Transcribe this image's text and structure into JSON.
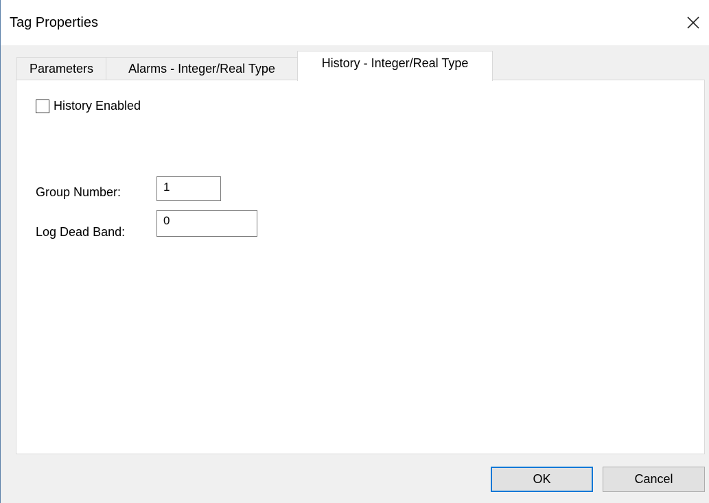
{
  "window": {
    "title": "Tag Properties",
    "close_icon": "close-icon"
  },
  "tabs": [
    {
      "label": "Parameters",
      "selected": false
    },
    {
      "label": "Alarms - Integer/Real Type",
      "selected": false
    },
    {
      "label": "History - Integer/Real Type",
      "selected": true
    }
  ],
  "history": {
    "enabled_label": "History Enabled",
    "enabled_checked": false,
    "group_number_label": "Group Number:",
    "group_number_value": "1",
    "log_dead_band_label": "Log Dead Band:",
    "log_dead_band_value": "0"
  },
  "buttons": {
    "ok_label": "OK",
    "cancel_label": "Cancel"
  },
  "colors": {
    "accent": "#0078d7",
    "dialog_bg": "#f0f0f0",
    "panel_bg": "#ffffff"
  }
}
